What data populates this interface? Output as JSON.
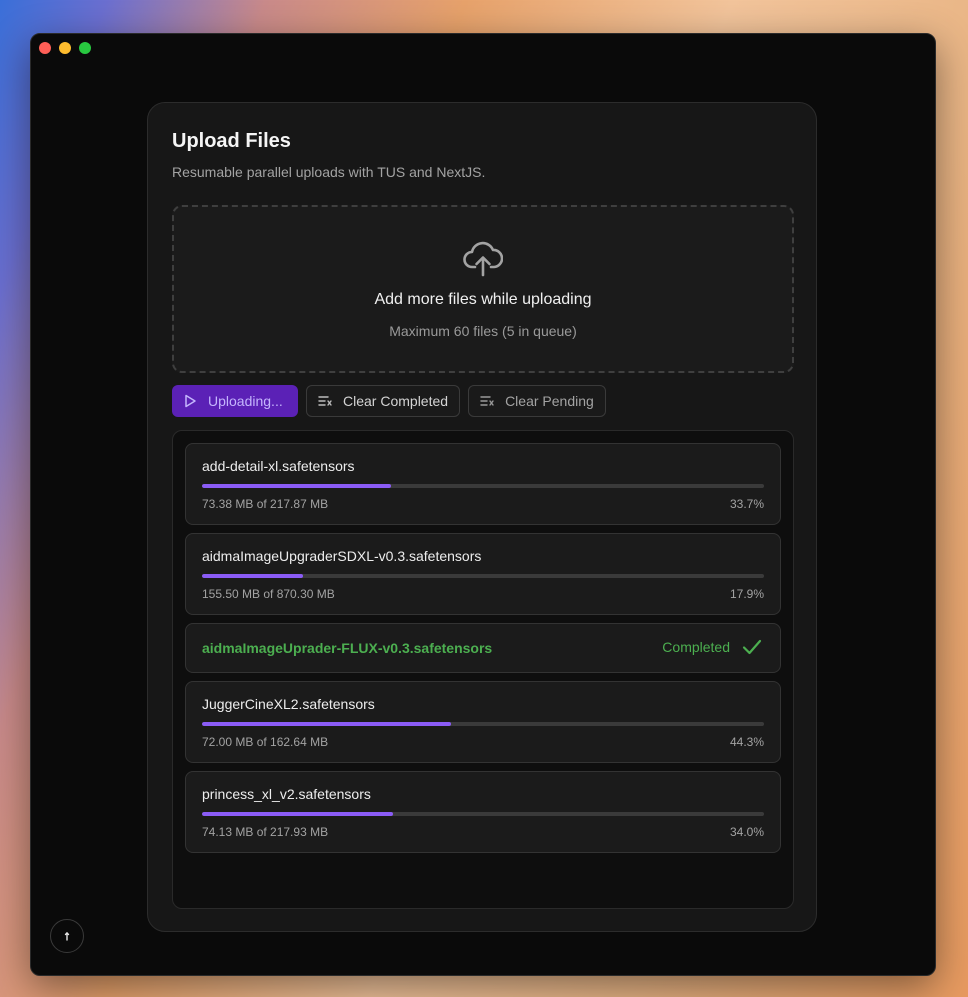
{
  "window": {
    "controls": [
      "close",
      "minimize",
      "maximize"
    ]
  },
  "card": {
    "title": "Upload Files",
    "subtitle": "Resumable parallel uploads with TUS and NextJS."
  },
  "dropzone": {
    "icon": "cloud-upload-icon",
    "title": "Add more files while uploading",
    "subtitle": "Maximum 60 files (5 in queue)"
  },
  "actions": {
    "upload_label": "Uploading...",
    "clear_completed_label": "Clear Completed",
    "clear_pending_label": "Clear Pending"
  },
  "files": [
    {
      "name": "add-detail-xl.safetensors",
      "size": "73.38 MB of 217.87 MB",
      "percent": "33.7%",
      "progress": 0.337,
      "status": "uploading"
    },
    {
      "name": "aidmaImageUpgraderSDXL-v0.3.safetensors",
      "size": "155.50 MB of 870.30 MB",
      "percent": "17.9%",
      "progress": 0.179,
      "status": "uploading"
    },
    {
      "name": "aidmaImageUprader-FLUX-v0.3.safetensors",
      "status": "completed",
      "status_label": "Completed"
    },
    {
      "name": "JuggerCineXL2.safetensors",
      "size": "72.00 MB of 162.64 MB",
      "percent": "44.3%",
      "progress": 0.443,
      "status": "uploading"
    },
    {
      "name": "princess_xl_v2.safetensors",
      "size": "74.13 MB of 217.93 MB",
      "percent": "34.0%",
      "progress": 0.34,
      "status": "uploading"
    }
  ],
  "colors": {
    "accent": "#8b5cf6",
    "primary_button": "#5b21b6",
    "success": "#4caf50"
  }
}
